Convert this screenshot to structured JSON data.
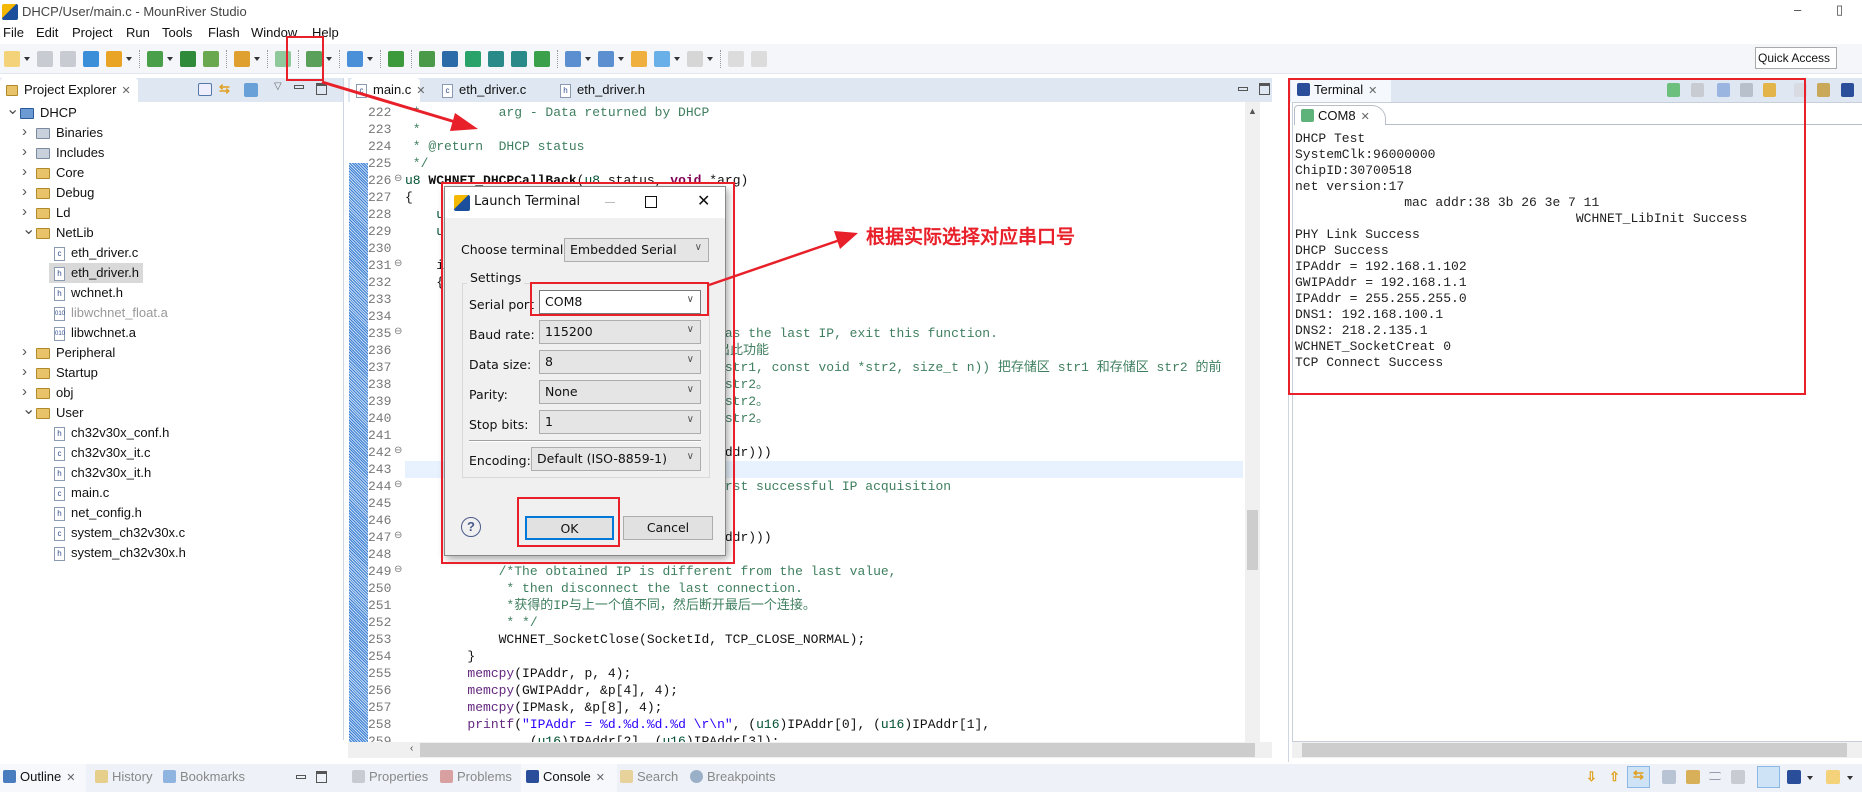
{
  "window": {
    "title": "DHCP/User/main.c - MounRiver Studio",
    "minimize": "–",
    "restore": "▯"
  },
  "menu": [
    "File",
    "Edit",
    "Project",
    "Run",
    "Tools",
    "Flash",
    "Window",
    "Help"
  ],
  "toolbar": {
    "icons": [
      {
        "name": "new-icon",
        "color": "#f3d27a",
        "dd": true
      },
      {
        "name": "save-icon",
        "color": "#c8ccd2"
      },
      {
        "name": "save-all-icon",
        "color": "#c8ccd2"
      },
      {
        "name": "project-icon",
        "color": "#3a8fd8"
      },
      {
        "name": "build-config-icon",
        "color": "#e9a425",
        "dd": true,
        "sep": true
      },
      {
        "name": "download-icon",
        "color": "#4aa04a",
        "dd": true
      },
      {
        "name": "build-all-icon",
        "color": "#2f8a3a"
      },
      {
        "name": "layers-icon",
        "color": "#6aa84f",
        "sep": true
      },
      {
        "name": "flash-icon",
        "color": "#e0a030",
        "dd": true,
        "sep": true
      },
      {
        "name": "terminal-icon",
        "color": "#8fc89a",
        "sep": true
      },
      {
        "name": "debug-bug-icon",
        "color": "#5aa05a",
        "dd": true,
        "sep": true
      },
      {
        "name": "search-icon",
        "color": "#4a90d9",
        "dd": true,
        "sep": true
      },
      {
        "name": "ld-file-icon",
        "color": "#3c9a3c",
        "sep": true
      },
      {
        "name": "help-file-icon",
        "color": "#4a9a4a"
      },
      {
        "name": "console-icon",
        "color": "#2b6ca8"
      },
      {
        "name": "k-icon",
        "color": "#29a36a"
      },
      {
        "name": "indent-right-icon",
        "color": "#2a8a8a"
      },
      {
        "name": "indent-left-icon",
        "color": "#2a8a8a"
      },
      {
        "name": "comment-toggle-icon",
        "color": "#3aa04a",
        "sep": true
      },
      {
        "name": "next-annotation-icon",
        "color": "#5b8fd0",
        "dd": true
      },
      {
        "name": "prev-annotation-icon",
        "color": "#5b8fd0",
        "dd": true
      },
      {
        "name": "last-edit-icon",
        "color": "#f0b040"
      },
      {
        "name": "back-icon",
        "color": "#6ab0e8",
        "dd": true
      },
      {
        "name": "forward-icon",
        "color": "#d6d6d6",
        "dd": true,
        "sep": true
      },
      {
        "name": "pin-left-icon",
        "color": "#dcdcdc"
      },
      {
        "name": "pin-right-icon",
        "color": "#dcdcdc"
      }
    ],
    "quick_access": "Quick Access"
  },
  "project_explorer": {
    "title": "Project Explorer",
    "items": [
      {
        "label": "DHCP",
        "level": 0,
        "state": "open",
        "kind": "project"
      },
      {
        "label": "Binaries",
        "level": 1,
        "state": "closed",
        "kind": "binaries"
      },
      {
        "label": "Includes",
        "level": 1,
        "state": "closed",
        "kind": "includes"
      },
      {
        "label": "Core",
        "level": 1,
        "state": "closed",
        "kind": "src-folder"
      },
      {
        "label": "Debug",
        "level": 1,
        "state": "closed",
        "kind": "src-folder"
      },
      {
        "label": "Ld",
        "level": 1,
        "state": "closed",
        "kind": "folder"
      },
      {
        "label": "NetLib",
        "level": 1,
        "state": "open",
        "kind": "src-folder"
      },
      {
        "label": "eth_driver.c",
        "level": 2,
        "kind": "c"
      },
      {
        "label": "eth_driver.h",
        "level": 2,
        "kind": "h",
        "selected": true
      },
      {
        "label": "wchnet.h",
        "level": 2,
        "kind": "h"
      },
      {
        "label": "libwchnet_float.a",
        "level": 2,
        "kind": "lib",
        "disabled": true
      },
      {
        "label": "libwchnet.a",
        "level": 2,
        "kind": "lib"
      },
      {
        "label": "Peripheral",
        "level": 1,
        "state": "closed",
        "kind": "src-folder"
      },
      {
        "label": "Startup",
        "level": 1,
        "state": "closed",
        "kind": "src-folder"
      },
      {
        "label": "obj",
        "level": 1,
        "state": "closed",
        "kind": "folder"
      },
      {
        "label": "User",
        "level": 1,
        "state": "open",
        "kind": "folder"
      },
      {
        "label": "ch32v30x_conf.h",
        "level": 2,
        "kind": "h"
      },
      {
        "label": "ch32v30x_it.c",
        "level": 2,
        "kind": "c"
      },
      {
        "label": "ch32v30x_it.h",
        "level": 2,
        "kind": "h"
      },
      {
        "label": "main.c",
        "level": 2,
        "kind": "c"
      },
      {
        "label": "net_config.h",
        "level": 2,
        "kind": "h"
      },
      {
        "label": "system_ch32v30x.c",
        "level": 2,
        "kind": "c"
      },
      {
        "label": "system_ch32v30x.h",
        "level": 2,
        "kind": "h"
      }
    ]
  },
  "editor": {
    "tabs": [
      {
        "label": "main.c",
        "active": true,
        "ext": "c"
      },
      {
        "label": "eth_driver.c",
        "ext": "c"
      },
      {
        "label": "eth_driver.h",
        "ext": "h"
      }
    ],
    "first_line": 222,
    "current_line": 243,
    "fold_lines": [
      226,
      231,
      235,
      242,
      244,
      247,
      249
    ],
    "lines": [
      [
        [
          "c",
          " *          arg - Data returned by DHCP"
        ]
      ],
      [
        [
          "c",
          " *"
        ]
      ],
      [
        [
          "c",
          " * @return  DHCP status"
        ]
      ],
      [
        [
          "c",
          " */"
        ]
      ],
      [
        [
          "t",
          "u8 "
        ],
        [
          "b",
          "WCHNET_DHCPCallBack"
        ],
        [
          "n",
          "("
        ],
        [
          "t",
          "u8"
        ],
        [
          "n",
          " status, "
        ],
        [
          "kw",
          "void"
        ],
        [
          "n",
          " *arg)"
        ]
      ],
      [
        [
          "n",
          "{"
        ]
      ],
      [
        [
          "t",
          "    u"
        ]
      ],
      [
        [
          "t",
          "    u"
        ]
      ],
      [],
      [
        [
          "n",
          "    i"
        ]
      ],
      [
        [
          "n",
          "    {"
        ]
      ],
      [],
      [],
      [
        [
          "c",
          "                                         as the last IP, exit this function."
        ]
      ],
      [
        [
          "c",
          "                                        出此功能"
        ]
      ],
      [
        [
          "c",
          "                                        *str1, const void *str2, size_t n)) 把存储区 str1 和存储区 str2 的前"
        ]
      ],
      [
        [
          "c",
          "                                         str2。"
        ]
      ],
      [
        [
          "c",
          "                                         str2。"
        ]
      ],
      [
        [
          "c",
          "                                         str2。"
        ]
      ],
      [],
      [
        [
          "n",
          "                                         ddr)))"
        ]
      ],
      [],
      [
        [
          "c",
          "                                         rst successful IP acquisition"
        ]
      ],
      [],
      [],
      [
        [
          "n",
          "                                        Addr)))"
        ]
      ],
      [],
      [
        [
          "c",
          "            /*The obtained IP is different from the last value,"
        ]
      ],
      [
        [
          "c",
          "             * then disconnect the last connection."
        ]
      ],
      [
        [
          "c",
          "             *获得的IP与上一个值不同，然后断开最后一个连接。"
        ]
      ],
      [
        [
          "c",
          "             * */"
        ]
      ],
      [
        [
          "n",
          "            WCHNET_SocketClose(SocketId, TCP_CLOSE_NORMAL);"
        ]
      ],
      [
        [
          "n",
          "        }"
        ]
      ],
      [
        [
          "n",
          "        "
        ],
        [
          "fn",
          "memcpy"
        ],
        [
          "n",
          "(IPAddr, p, 4);"
        ]
      ],
      [
        [
          "n",
          "        "
        ],
        [
          "fn",
          "memcpy"
        ],
        [
          "n",
          "(GWIPAddr, &p[4], 4);"
        ]
      ],
      [
        [
          "n",
          "        "
        ],
        [
          "fn",
          "memcpy"
        ],
        [
          "n",
          "(IPMask, &p[8], 4);"
        ]
      ],
      [
        [
          "n",
          "        "
        ],
        [
          "fn",
          "printf"
        ],
        [
          "n",
          "("
        ],
        [
          "s",
          "\"IPAddr = %d.%d.%d.%d \\r\\n\""
        ],
        [
          "n",
          ", ("
        ],
        [
          "t",
          "u16"
        ],
        [
          "n",
          ")IPAddr[0], ("
        ],
        [
          "t",
          "u16"
        ],
        [
          "n",
          ")IPAddr[1],"
        ]
      ],
      [
        [
          "n",
          "                ("
        ],
        [
          "t",
          "u16"
        ],
        [
          "n",
          ")IPAddr[2], ("
        ],
        [
          "t",
          "u16"
        ],
        [
          "n",
          ")IPAddr[3]);"
        ]
      ]
    ]
  },
  "terminal": {
    "view_title": "Terminal",
    "tab": "COM8",
    "lines": [
      "DHCP Test",
      "SystemClk:96000000",
      "ChipID:30700518",
      "net version:17",
      "              mac addr:38 3b 26 3e 7 11",
      "                                    WCHNET_LibInit Success",
      "PHY Link Success",
      "DHCP Success",
      "IPAddr = 192.168.1.102",
      "GWIPAddr = 192.168.1.1",
      "IPAddr = 255.255.255.0",
      "DNS1: 192.168.100.1",
      "DNS2: 218.2.135.1",
      "WCHNET_SocketCreat 0",
      "TCP Connect Success"
    ]
  },
  "dialog": {
    "title": "Launch Terminal",
    "choose_terminal_label": "Choose terminal:",
    "choose_terminal_value": "Embedded Serial",
    "settings_label": "Settings",
    "serial_port_label": "Serial port",
    "serial_port_value": "COM8",
    "baud_rate_label": "Baud rate:",
    "baud_rate_value": "115200",
    "data_size_label": "Data size:",
    "data_size_value": "8",
    "parity_label": "Parity:",
    "parity_value": "None",
    "stop_bits_label": "Stop bits:",
    "stop_bits_value": "1",
    "encoding_label": "Encoding:",
    "encoding_value": "Default (ISO-8859-1)",
    "ok": "OK",
    "cancel": "Cancel",
    "help": "?"
  },
  "annotation": {
    "text": "根据实际选择对应串口号",
    "color": "#e8202a"
  },
  "bottom": {
    "left_tabs": [
      "Outline",
      "History",
      "Bookmarks"
    ],
    "right_tabs": [
      "Properties",
      "Problems",
      "Console",
      "Search",
      "Breakpoints"
    ],
    "active_right": "Console"
  }
}
